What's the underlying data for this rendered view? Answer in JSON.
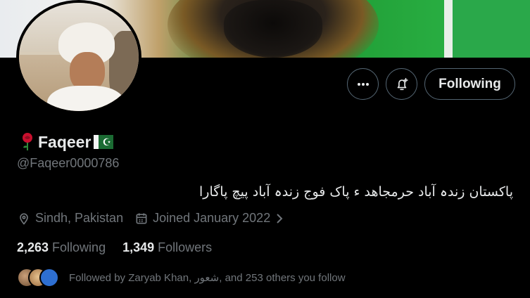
{
  "profile": {
    "name": "Faqeer",
    "handle": "@Faqeer0000786",
    "bio": "پاکستان زندہ آباد حرمجاھد ء پاک فوج زندہ آباد پیچ پاگارا",
    "location": "Sindh, Pakistan",
    "joined": "Joined January 2022",
    "following_count": "2,263",
    "following_label": "Following",
    "followers_count": "1,349",
    "followers_label": "Followers",
    "followed_by_text": "Followed by Zaryab Khan, شعور, and 253 others you follow"
  },
  "actions": {
    "following_button": "Following"
  },
  "icons": {
    "more": "more-icon",
    "notify": "bell-plus-icon",
    "location": "location-pin-icon",
    "calendar": "calendar-icon",
    "chevron": "chevron-right-icon"
  },
  "colors": {
    "background": "#000000",
    "text_primary": "#e7e9ea",
    "text_secondary": "#71767b",
    "border": "#536471"
  }
}
